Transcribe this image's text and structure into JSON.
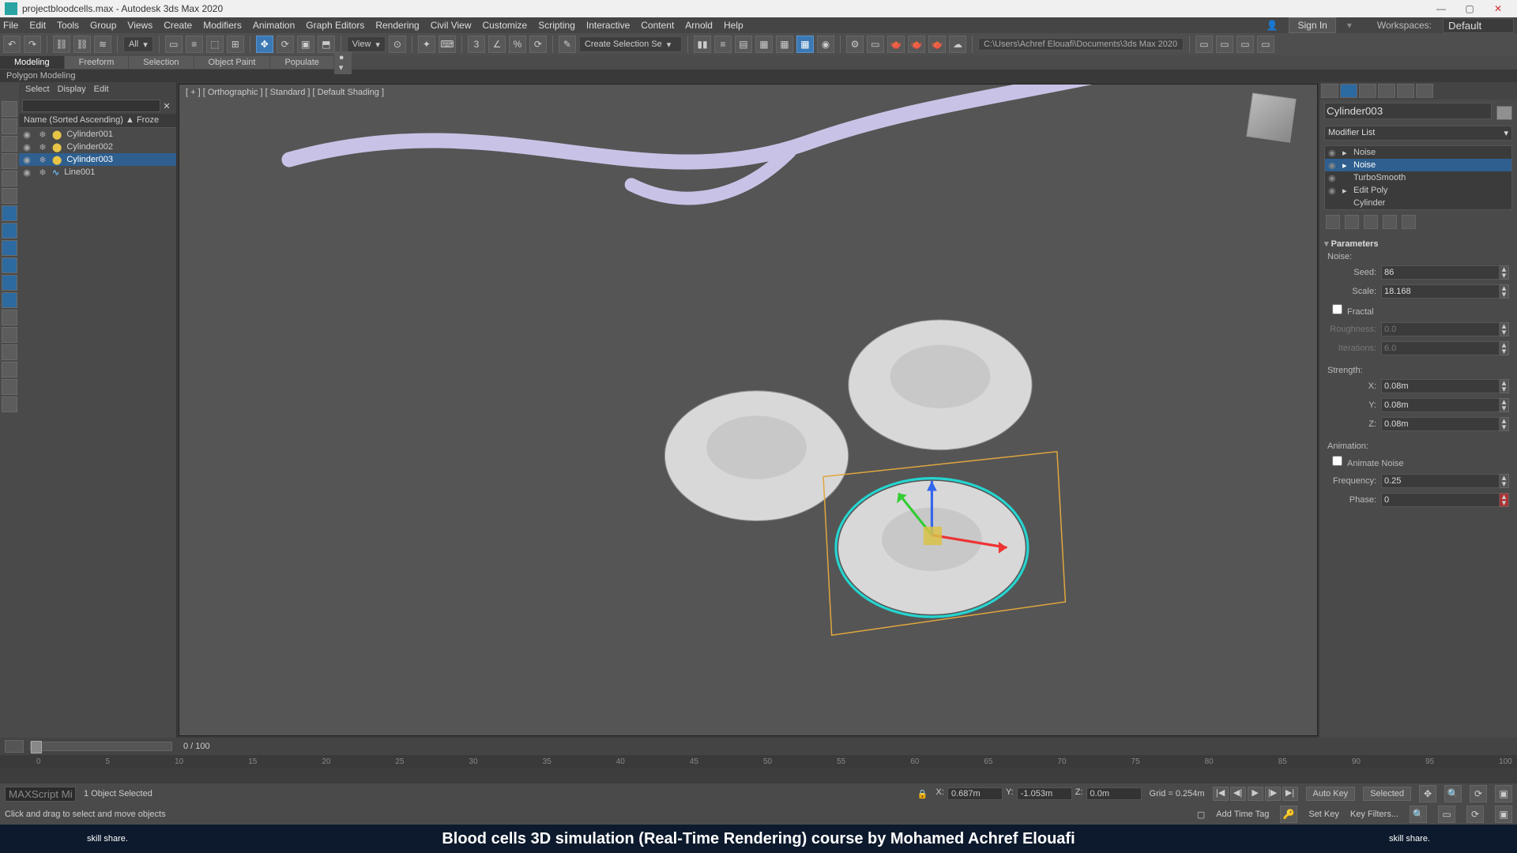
{
  "title": "projectbloodcells.max - Autodesk 3ds Max 2020",
  "menus": [
    "File",
    "Edit",
    "Tools",
    "Group",
    "Views",
    "Create",
    "Modifiers",
    "Animation",
    "Graph Editors",
    "Rendering",
    "Civil View",
    "Customize",
    "Scripting",
    "Interactive",
    "Content",
    "Arnold",
    "Help"
  ],
  "signin": "Sign In",
  "workspaces_label": "Workspaces:",
  "workspace": "Default",
  "toolbar": {
    "dd_all": "All",
    "dd_view": "View",
    "dd_selset": "Create Selection Se"
  },
  "path": "C:\\Users\\Achref Elouafi\\Documents\\3ds Max 2020",
  "ribbon_tabs": [
    "Modeling",
    "Freeform",
    "Selection",
    "Object Paint",
    "Populate"
  ],
  "ribbon_active": 0,
  "subribbon": "Polygon Modeling",
  "explorer": {
    "tabs": [
      "Select",
      "Display",
      "Edit"
    ],
    "header": "Name (Sorted Ascending)   ▲  Froze",
    "rows": [
      {
        "name": "Cylinder001",
        "sel": false,
        "type": "cyl"
      },
      {
        "name": "Cylinder002",
        "sel": false,
        "type": "cyl"
      },
      {
        "name": "Cylinder003",
        "sel": true,
        "type": "cyl"
      },
      {
        "name": "Line001",
        "sel": false,
        "type": "line"
      }
    ]
  },
  "viewport_label": "[ + ] [ Orthographic ] [ Standard ] [ Default Shading ]",
  "cmd": {
    "object_name": "Cylinder003",
    "modlist": "Modifier List",
    "stack": [
      {
        "label": "Noise",
        "sel": false,
        "eye": true,
        "arr": true
      },
      {
        "label": "Noise",
        "sel": true,
        "eye": true,
        "arr": true
      },
      {
        "label": "TurboSmooth",
        "sel": false,
        "eye": true,
        "arr": false
      },
      {
        "label": "Edit Poly",
        "sel": false,
        "eye": true,
        "arr": true
      },
      {
        "label": "Cylinder",
        "sel": false,
        "eye": false,
        "arr": false
      }
    ],
    "params_title": "Parameters",
    "noise_label": "Noise:",
    "seed_label": "Seed:",
    "seed": "86",
    "scale_label": "Scale:",
    "scale": "18.168",
    "fractal": "Fractal",
    "rough_label": "Roughness:",
    "rough": "0.0",
    "iter_label": "Iterations:",
    "iter": "6.0",
    "strength": "Strength:",
    "x_label": "X:",
    "x": "0.08m",
    "y_label": "Y:",
    "y": "0.08m",
    "z_label": "Z:",
    "z": "0.08m",
    "anim": "Animation:",
    "anim_noise": "Animate Noise",
    "freq_label": "Frequency:",
    "freq": "0.25",
    "phase_label": "Phase:",
    "phase": "0"
  },
  "frame": "0 / 100",
  "ticks": [
    "0",
    "5",
    "10",
    "15",
    "20",
    "25",
    "30",
    "35",
    "40",
    "45",
    "50",
    "55",
    "60",
    "65",
    "70",
    "75",
    "80",
    "85",
    "90",
    "95",
    "100"
  ],
  "coords": {
    "x_label": "X:",
    "x": "0.687m",
    "y_label": "Y:",
    "y": "-1.053m",
    "z_label": "Z:",
    "z": "0.0m"
  },
  "grid": "Grid = 0.254m",
  "autokey": "Auto Key",
  "setkey": "Set Key",
  "selected": "Selected",
  "status_sel": "1 Object Selected",
  "status_hint": "Click and drag to select and move objects",
  "maxscript": "MAXScript Mi",
  "addtag": "Add Time Tag",
  "keyfilters": "Key Filters...",
  "banner": {
    "left": "skill share.",
    "main": "Blood cells 3D simulation (Real-Time Rendering) course by Mohamed Achref Elouafi",
    "right": "skill share."
  }
}
